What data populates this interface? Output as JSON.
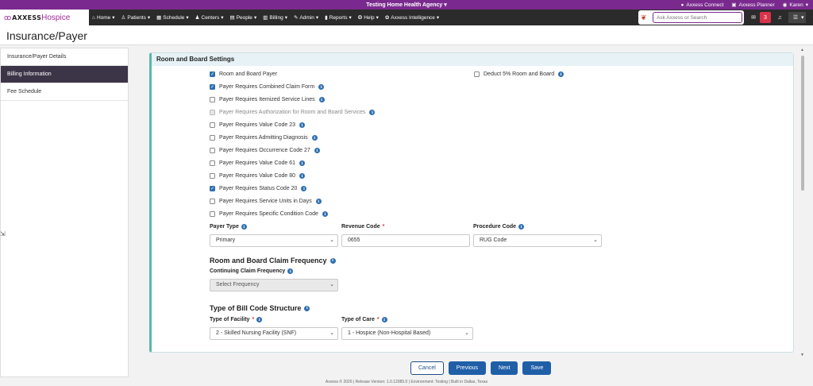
{
  "topbar": {
    "agency": "Testing Home Health Agency",
    "links": [
      {
        "icon": "chat-icon",
        "label": "Axxess Connect"
      },
      {
        "icon": "calendar-icon",
        "label": "Axxess Planner"
      },
      {
        "icon": "user-circle-icon",
        "label": "Karen"
      }
    ]
  },
  "navbar": {
    "logo_word": "AXXESS",
    "logo_product": "Hospice",
    "menu": [
      "Home",
      "Patients",
      "Schedule",
      "Centers",
      "People",
      "Billing",
      "Admin",
      "Reports",
      "Help",
      "Axxess Intelligence"
    ],
    "search_placeholder": "Ask Axxess or Search",
    "message_count": "3"
  },
  "page": {
    "title": "Insurance/Payer"
  },
  "sidebar": {
    "items": [
      {
        "label": "Insurance/Payer Details",
        "active": false
      },
      {
        "label": "Billing Information",
        "active": true
      },
      {
        "label": "Fee Schedule",
        "active": false
      }
    ]
  },
  "card": {
    "title": "Room and Board Settings",
    "checkboxes": [
      {
        "label": "Room and Board Payer",
        "checked": true,
        "info": false,
        "disabled": false
      },
      {
        "label": "Payer Requires Combined Claim Form",
        "checked": true,
        "info": true,
        "disabled": false
      },
      {
        "label": "Payer Requires Itemized Service Lines",
        "checked": false,
        "info": true,
        "disabled": false
      },
      {
        "label": "Payer Requires Authorization for Room and Board Services",
        "checked": false,
        "info": true,
        "disabled": true
      },
      {
        "label": "Payer Requires Value Code 23",
        "checked": false,
        "info": true,
        "disabled": false
      },
      {
        "label": "Payer Requires Admitting Diagnosis",
        "checked": false,
        "info": true,
        "disabled": false
      },
      {
        "label": "Payer Requires Occurrence Code 27",
        "checked": false,
        "info": true,
        "disabled": false
      },
      {
        "label": "Payer Requires Value Code 61",
        "checked": false,
        "info": true,
        "disabled": false
      },
      {
        "label": "Payer Requires Value Code 80",
        "checked": false,
        "info": true,
        "disabled": false
      },
      {
        "label": "Payer Requires Status Code 20",
        "checked": true,
        "info": true,
        "disabled": false
      },
      {
        "label": "Payer Requires Service Units in Days",
        "checked": false,
        "info": true,
        "disabled": false
      },
      {
        "label": "Payer Requires Specific Condition Code",
        "checked": false,
        "info": true,
        "disabled": false
      }
    ],
    "deduct": {
      "label": "Deduct 5% Room and Board",
      "checked": false
    },
    "payer_type": {
      "label": "Payer Type",
      "value": "Primary"
    },
    "revenue_code": {
      "label": "Revenue Code",
      "required": "*",
      "value": "0655"
    },
    "procedure_code": {
      "label": "Procedure Code",
      "value": "RUG Code"
    },
    "claim_freq": {
      "heading": "Room and Board Claim Frequency",
      "label": "Continuing Claim Frequency",
      "value": "Select Frequency"
    },
    "bill_code": {
      "heading": "Type of Bill Code Structure",
      "facility_label": "Type of Facility",
      "facility_value": "2 - Skilled Nursing Facility (SNF)",
      "care_label": "Type of Care",
      "care_value": "1 - Hospice (Non-Hospital Based)",
      "required": "*"
    }
  },
  "buttons": {
    "cancel": "Cancel",
    "previous": "Previous",
    "next": "Next",
    "save": "Save"
  },
  "footnote": "Axxess © 2026 | Release Version: 1.0.12085.0 | Environment: Testing | Built in Dallas, Texas",
  "colors": {
    "brand": "#7a2a8e",
    "primary": "#1f5fa8",
    "accent": "#5bb8a8"
  }
}
